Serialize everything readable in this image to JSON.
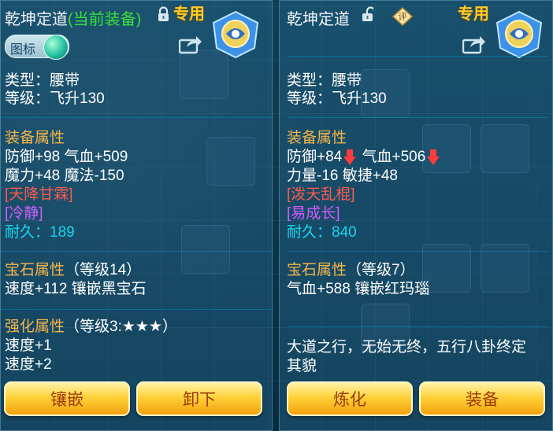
{
  "left": {
    "title": "乾坤定道",
    "current_tag": "(当前装备)",
    "exclusive": "专用",
    "toggle_label": "图标",
    "type_line": "类型：腰带",
    "level_line": "等级：飞升130",
    "attr_header": "装备属性",
    "attr_line1": "防御+98 气血+509",
    "attr_line2": "魔力+48 魔法-150",
    "special1": "[天降甘霖]",
    "special2": "[冷静]",
    "durability_label": "耐久：",
    "durability_value": "189",
    "gem_header": "宝石属性",
    "gem_level": "（等级14）",
    "gem_line": "速度+112 镶嵌黑宝石",
    "enhance_header": "强化属性",
    "enhance_level": "（等级3:★★★）",
    "enhance_line1": "速度+1",
    "enhance_line2": "速度+2",
    "buttons": {
      "inlay": "镶嵌",
      "unequip": "卸下"
    },
    "icons": {
      "lock": "lock-closed-icon",
      "share": "share-icon",
      "emblem": "exclusive-emblem-icon"
    }
  },
  "right": {
    "title": "乾坤定道",
    "exclusive": "专用",
    "eval_badge": "评",
    "type_line": "类型：腰带",
    "level_line": "等级：飞升130",
    "attr_header": "装备属性",
    "attr1a": "防御+84",
    "attr1b": "气血+506",
    "attr_line2": "力量-16 敏捷+48",
    "special1": "[泼天乱棍]",
    "special2": "[易成长]",
    "durability_label": "耐久：",
    "durability_value": "840",
    "gem_header": "宝石属性",
    "gem_level": "（等级7）",
    "gem_line": "气血+588 镶嵌红玛瑙",
    "desc_line1": "大道之行，无始无终，五行八卦终定",
    "desc_line2": "其貌",
    "buttons": {
      "refine": "炼化",
      "equip": "装备"
    },
    "icons": {
      "lock": "lock-open-icon",
      "share": "share-icon",
      "emblem": "exclusive-emblem-icon",
      "down": "red-down-arrow-icon"
    }
  },
  "colors": {
    "attr_header": "#f5b44a",
    "special_red": "#ff5b4b",
    "special_purple": "#d15cff",
    "durability": "#19d5f2",
    "current_tag": "#39e035",
    "exclusive": "#ffcc2a"
  }
}
